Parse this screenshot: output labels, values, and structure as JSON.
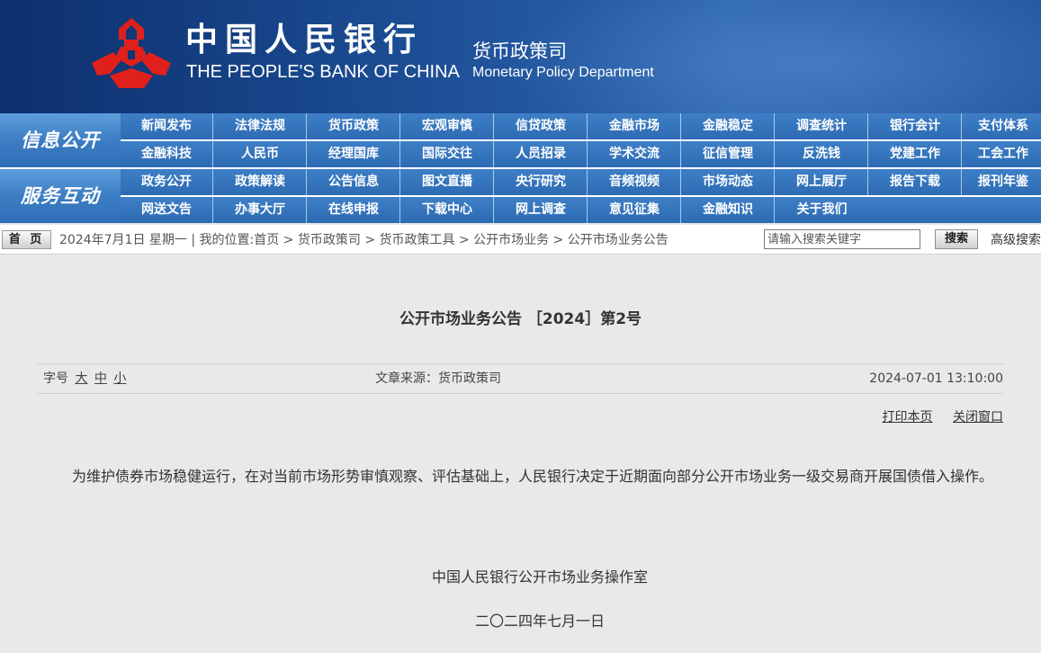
{
  "header": {
    "bank_name_cn": "中国人民银行",
    "bank_name_en": "THE PEOPLE'S BANK OF CHINA",
    "department_cn": "货币政策司",
    "department_en": "Monetary Policy Department",
    "logo_color": "#e0201b",
    "banner_color": "#1a4a90"
  },
  "nav": {
    "groups": [
      {
        "title": "信息公开",
        "rows": [
          [
            "新闻发布",
            "法律法规",
            "货币政策",
            "宏观审慎",
            "信贷政策",
            "金融市场",
            "金融稳定",
            "调查统计",
            "银行会计",
            "支付体系"
          ],
          [
            "金融科技",
            "人民币",
            "经理国库",
            "国际交往",
            "人员招录",
            "学术交流",
            "征信管理",
            "反洗钱",
            "党建工作",
            "工会工作"
          ]
        ]
      },
      {
        "title": "服务互动",
        "rows": [
          [
            "政务公开",
            "政策解读",
            "公告信息",
            "图文直播",
            "央行研究",
            "音频视频",
            "市场动态",
            "网上展厅",
            "报告下载",
            "报刊年鉴"
          ],
          [
            "网送文告",
            "办事大厅",
            "在线申报",
            "下载中心",
            "网上调查",
            "意见征集",
            "金融知识",
            "关于我们",
            "",
            ""
          ]
        ]
      }
    ]
  },
  "toolbar": {
    "home_label": "首 页",
    "date": "2024年7月1日 星期一",
    "location_label": "我的位置:",
    "breadcrumb": [
      "首页",
      "货币政策司",
      "货币政策工具",
      "公开市场业务",
      "公开市场业务公告"
    ],
    "search_placeholder": "请输入搜索关键字",
    "search_button": "搜索",
    "advanced_search": "高级搜索"
  },
  "article": {
    "title": "公开市场业务公告 ［2024］第2号",
    "font_size_label": "字号",
    "font_sizes": [
      "大",
      "中",
      "小"
    ],
    "source": "文章来源：货币政策司",
    "datetime": "2024-07-01 13:10:00",
    "print_label": "打印本页",
    "close_label": "关闭窗口",
    "body": "为维护债券市场稳健运行，在对当前市场形势审慎观察、评估基础上，人民银行决定于近期面向部分公开市场业务一级交易商开展国债借入操作。",
    "signature_org": "中国人民银行公开市场业务操作室",
    "signature_date": "二〇二四年七月一日"
  }
}
